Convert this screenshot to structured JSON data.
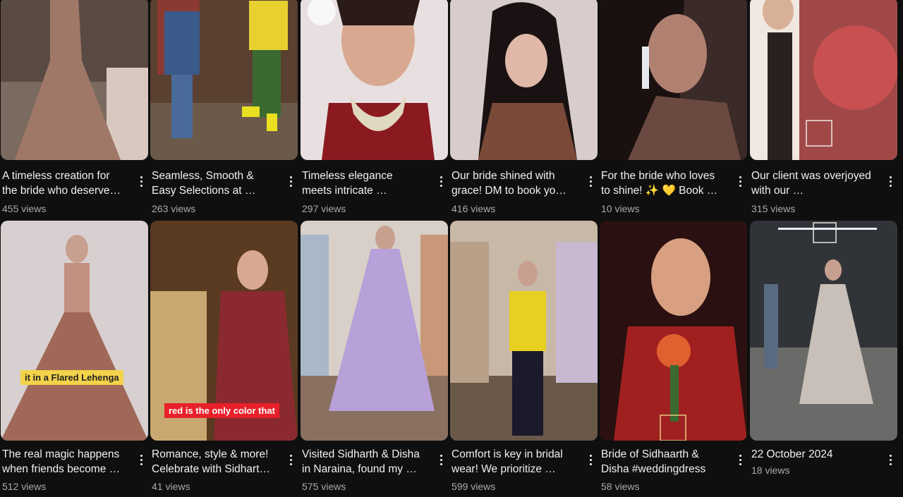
{
  "shorts": [
    {
      "title": "A timeless creation for the bride who deserve…",
      "views": "455 views",
      "overlay": "",
      "colors": [
        "#5a4a44",
        "#a07868",
        "#d8c8c0"
      ]
    },
    {
      "title": "Seamless, Smooth & Easy Selections at …",
      "views": "263 views",
      "overlay": "",
      "colors": [
        "#6b5a4a",
        "#3a5a8a",
        "#e8d030"
      ]
    },
    {
      "title": "Timeless elegance meets intricate …",
      "views": "297 views",
      "overlay": "",
      "colors": [
        "#e8e0e0",
        "#c88070",
        "#8a1a20"
      ]
    },
    {
      "title": "Our bride  shined with grace!  DM to book yo…",
      "views": "416 views",
      "overlay": "",
      "colors": [
        "#d8cccc",
        "#1a1212",
        "#7a4a38"
      ]
    },
    {
      "title": "For the bride who loves to shine! ✨ 💛  Book …",
      "views": "10 views",
      "overlay": "",
      "colors": [
        "#3a2a28",
        "#b08070",
        "#6a4a40"
      ]
    },
    {
      "title": "Our client was overjoyed with our …",
      "views": "315 views",
      "overlay": "",
      "colors": [
        "#f0e8e0",
        "#2a2020",
        "#c85050"
      ]
    },
    {
      "title": "The real magic happens when friends become …",
      "views": "512 views",
      "overlay": "it in a Flared Lehenga",
      "colors": [
        "#d8d0d0",
        "#c09080",
        "#a06858"
      ]
    },
    {
      "title": "Romance, style & more! Celebrate with Sidhart…",
      "views": "41 views",
      "overlay": "red is the only color that",
      "colors": [
        "#5a3a20",
        "#8a2a30",
        "#c8a870"
      ]
    },
    {
      "title": "Visited Sidharth & Disha in Naraina, found my …",
      "views": "575 views",
      "overlay": "",
      "colors": [
        "#d8d0c8",
        "#b8a0d8",
        "#8a7060"
      ]
    },
    {
      "title": "Comfort is key in bridal wear! We prioritize …",
      "views": "599 views",
      "overlay": "",
      "colors": [
        "#c8b8a8",
        "#e8d020",
        "#1a1a2a"
      ]
    },
    {
      "title": "Bride of Sidhaarth & Disha #weddingdress",
      "views": "58 views",
      "overlay": "",
      "colors": [
        "#2a1010",
        "#a02020",
        "#e06030"
      ]
    },
    {
      "title": "22 October 2024",
      "views": "18 views",
      "overlay": "",
      "colors": [
        "#303438",
        "#c8c0b8",
        "#5a6a80"
      ]
    }
  ]
}
